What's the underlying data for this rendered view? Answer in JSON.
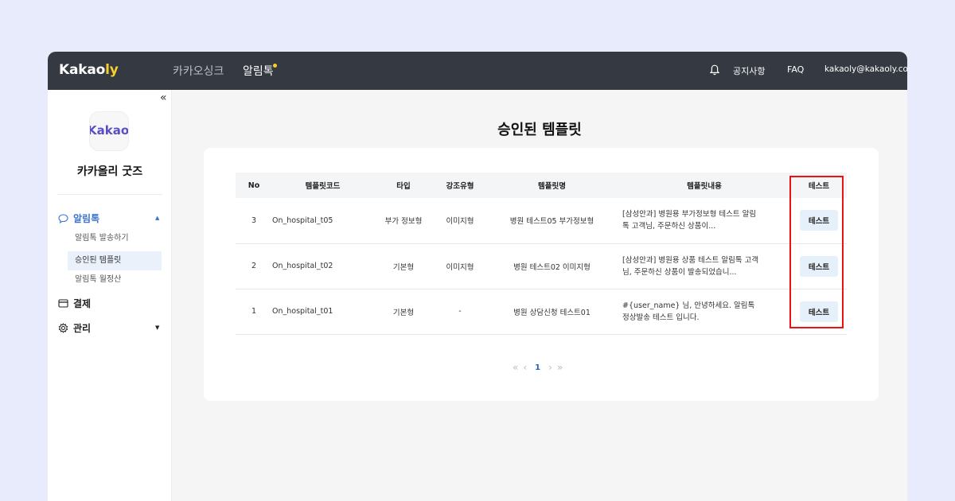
{
  "header": {
    "logo_main": "Kakao",
    "logo_accent": "ly",
    "nav": [
      {
        "label": "카카오싱크"
      },
      {
        "label": "알림톡"
      }
    ],
    "notice_label": "공지사항",
    "faq_label": "FAQ",
    "email": "kakaoly@kakaoly.com"
  },
  "sidebar": {
    "collapse": "«",
    "avatar_main": "Kakao",
    "avatar_accent": "ly",
    "store_name": "카카올리 굿즈",
    "menu": {
      "alimtalk": "알림톡",
      "sub_items": [
        "알림톡 발송하기",
        "승인된 템플릿",
        "알림톡 월정산"
      ],
      "payment": "결제",
      "management": "관리"
    }
  },
  "main": {
    "title": "승인된 템플릿",
    "table": {
      "headers": [
        "No",
        "템플릿코드",
        "타입",
        "강조유형",
        "템플릿명",
        "템플릿내용",
        "테스트"
      ],
      "rows": [
        {
          "no": "3",
          "code": "On_hospital_t05",
          "type": "부가 정보형",
          "emphasis": "이미지형",
          "name": "병원 테스트05 부가정보형",
          "content": "[삼성안과] 병원용 부가정보형 테스트 알림톡 고객님, 주문하신 상품이...",
          "test": "테스트"
        },
        {
          "no": "2",
          "code": "On_hospital_t02",
          "type": "기본형",
          "emphasis": "이미지형",
          "name": "병원 테스트02 이미지형",
          "content": "[삼성안과] 병원용 상품 테스트 알림톡 고객님, 주문하신 상품이 발송되었습니...",
          "test": "테스트"
        },
        {
          "no": "1",
          "code": "On_hospital_t01",
          "type": "기본형",
          "emphasis": "-",
          "name": "병원 상담신청 테스트01",
          "content": "#{user_name} 님, 안녕하세요. 알림톡 정상발송 테스트 입니다.",
          "test": "테스트"
        }
      ]
    },
    "pagination": {
      "first": "«",
      "prev": "‹",
      "current": "1",
      "next": "›",
      "last": "»"
    }
  }
}
